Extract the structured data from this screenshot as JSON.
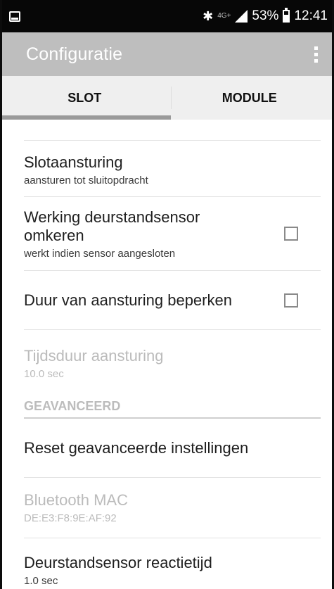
{
  "status_bar": {
    "battery_text": "53%",
    "time": "12:41",
    "network_label": "4G+",
    "icons": [
      "screenshot-icon",
      "bluetooth-icon",
      "network-icon",
      "signal-icon",
      "battery-icon"
    ]
  },
  "app_bar": {
    "title": "Configuratie",
    "menu_icon": "overflow-menu-icon"
  },
  "tabs": [
    {
      "label": "SLOT",
      "selected": true
    },
    {
      "label": "MODULE",
      "selected": false
    }
  ],
  "preferences": {
    "slotaansturing": {
      "title": "Slotaansturing",
      "summary": "aansturen tot sluitopdracht"
    },
    "omkeren": {
      "title_line1": "Werking deurstandsensor",
      "title_line2": "omkeren",
      "summary": "werkt indien sensor aangesloten",
      "checked": false
    },
    "beperken": {
      "title": "Duur van aansturing beperken",
      "checked": false
    },
    "tijdsduur": {
      "title": "Tijdsduur aansturing",
      "summary": "10.0 sec",
      "enabled": false
    },
    "section_advanced": "GEAVANCEERD",
    "reset": {
      "title": "Reset geavanceerde instellingen"
    },
    "bluetooth": {
      "title": "Bluetooth MAC",
      "summary": "DE:E3:F8:9E:AF:92",
      "enabled": false
    },
    "reactietijd": {
      "title": "Deurstandsensor reactietijd",
      "summary": "1.0 sec"
    }
  },
  "colors": {
    "app_bar": "#bebebe",
    "tab_bar": "#efefef",
    "tab_indicator": "#9a9a9a",
    "status_bar": "#070707"
  }
}
